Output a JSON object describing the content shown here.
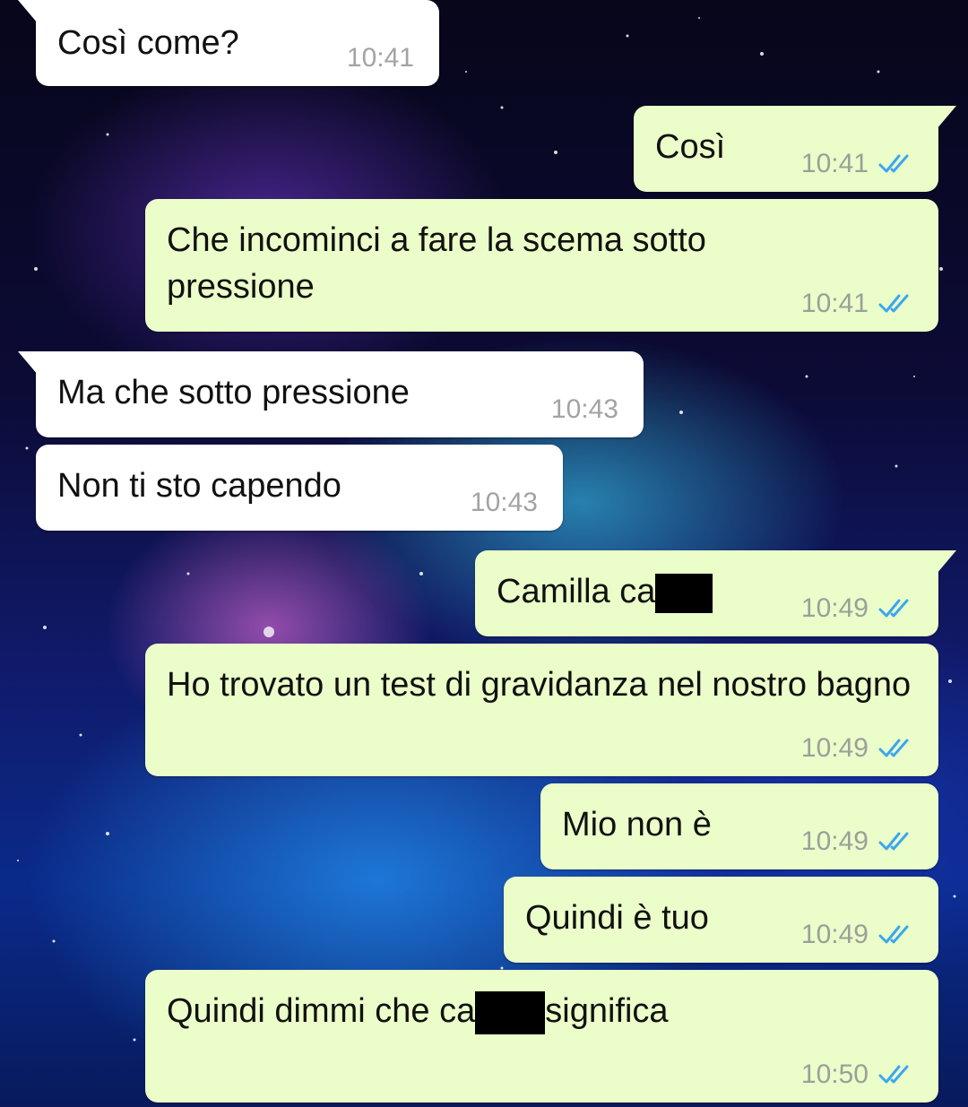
{
  "messages": [
    {
      "dir": "in",
      "text": "Così come?",
      "time": "10:41"
    },
    {
      "dir": "out",
      "text": "Così",
      "time": "10:41"
    },
    {
      "dir": "out",
      "text": "Che incominci a fare la scema sotto pressione",
      "time": "10:41"
    },
    {
      "dir": "in",
      "text": "Ma che sotto pressione",
      "time": "10:43"
    },
    {
      "dir": "in",
      "text": "Non ti sto capendo",
      "time": "10:43"
    },
    {
      "dir": "out",
      "text_before": "Camilla ca",
      "text_after": "",
      "time": "10:49"
    },
    {
      "dir": "out",
      "text": "Ho trovato un test di gravidanza nel nostro bagno",
      "time": "10:49"
    },
    {
      "dir": "out",
      "text": "Mio non è",
      "time": "10:49"
    },
    {
      "dir": "out",
      "text": "Quindi è tuo",
      "time": "10:49"
    },
    {
      "dir": "out",
      "text_before": "Quindi dimmi che ca",
      "text_after": "significa",
      "time": "10:50"
    }
  ],
  "colors": {
    "incoming_bubble": "#ffffff",
    "outgoing_bubble": "#ebfdc9",
    "read_ticks": "#3ba7f0"
  },
  "icons": {
    "read_receipt": "double-check-icon"
  }
}
